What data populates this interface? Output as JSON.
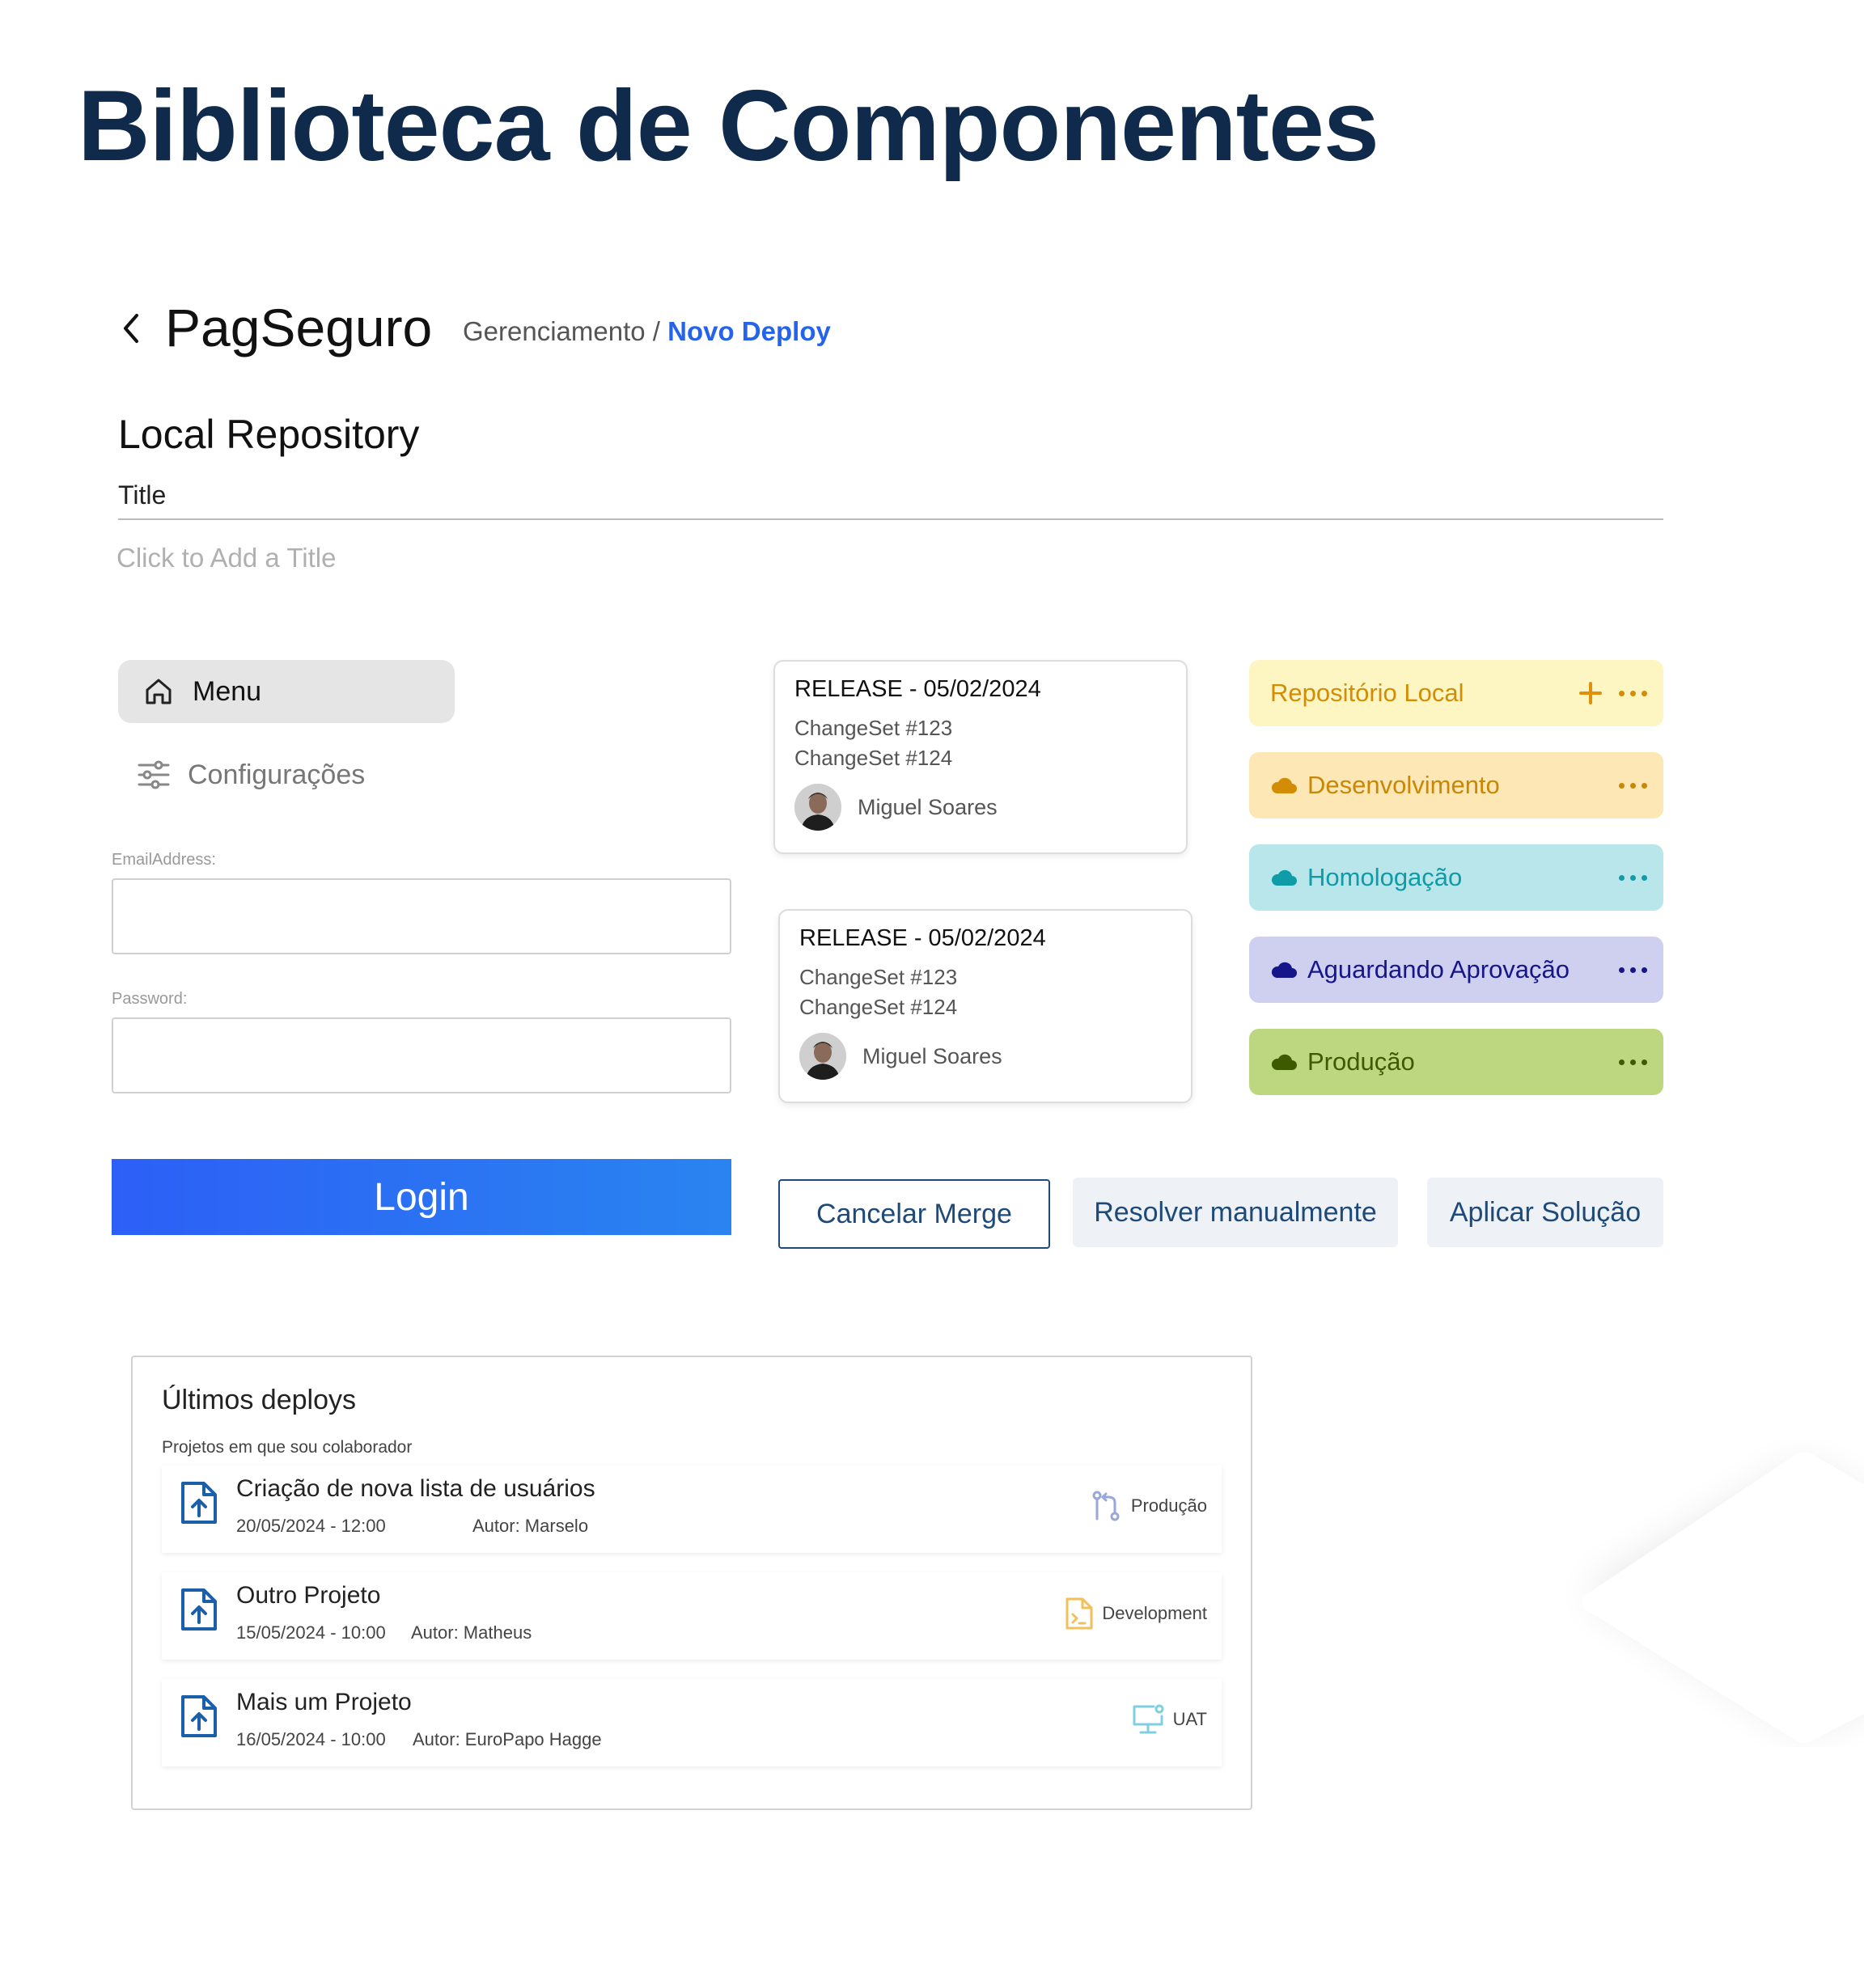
{
  "page": {
    "title": "Biblioteca de Componentes"
  },
  "header": {
    "brand": "PagSeguro",
    "breadcrumb_parent": "Gerenciamento",
    "breadcrumb_sep": " / ",
    "breadcrumb_current": "Novo Deploy"
  },
  "repository": {
    "title": "Local Repository",
    "field_label": "Title",
    "field_placeholder": "Click to Add a Title",
    "field_value": ""
  },
  "menu": {
    "items": [
      {
        "label": "Menu",
        "icon": "home-icon",
        "active": true
      },
      {
        "label": "Configurações",
        "icon": "sliders-icon",
        "active": false
      }
    ]
  },
  "form": {
    "email_label": "EmailAddress:",
    "email_value": "",
    "password_label": "Password:",
    "password_value": "",
    "login_label": "Login"
  },
  "releases": [
    {
      "title": "RELEASE - 05/02/2024",
      "changesets": [
        "ChangeSet #123",
        "ChangeSet #124"
      ],
      "author": "Miguel Soares"
    },
    {
      "title": "RELEASE - 05/02/2024",
      "changesets": [
        "ChangeSet #123",
        "ChangeSet #124"
      ],
      "author": "Miguel Soares"
    }
  ],
  "stages": [
    {
      "label": "Repositório Local",
      "icon": "plus-icon",
      "color": "#d38c05",
      "bg": "#fef6c2"
    },
    {
      "label": "Desenvolvimento",
      "icon": "cloud-icon",
      "color": "#c98706",
      "bg": "#fde7b4"
    },
    {
      "label": "Homologação",
      "icon": "cloud-icon",
      "color": "#0f9ba8",
      "bg": "#b9e6ea"
    },
    {
      "label": "Aguardando Aprovação",
      "icon": "cloud-icon",
      "color": "#16168a",
      "bg": "#cfd0f0"
    },
    {
      "label": "Produção",
      "icon": "cloud-icon",
      "color": "#3d5a00",
      "bg": "#bdd780"
    }
  ],
  "actions": {
    "cancel_merge": "Cancelar Merge",
    "resolve_manual": "Resolver manualmente",
    "apply_solution": "Aplicar Solução"
  },
  "deploys": {
    "title": "Últimos deploys",
    "subtitle": "Projetos em que sou colaborador",
    "items": [
      {
        "name": "Criação de nova lista de usuários",
        "date": "20/05/2024 - 12:00",
        "author": "Autor: Marselo",
        "env": "Produção",
        "env_icon": "git-merge-icon"
      },
      {
        "name": "Outro Projeto",
        "date": "15/05/2024 - 10:00",
        "author": "Autor: Matheus",
        "env": "Development",
        "env_icon": "terminal-file-icon"
      },
      {
        "name": "Mais um Projeto",
        "date": "16/05/2024 - 10:00",
        "author": "Autor: EuroPapo Hagge",
        "env": "UAT",
        "env_icon": "monitor-icon"
      }
    ]
  },
  "colors": {
    "title": "#0f2a4a",
    "link": "#2563eb",
    "primary_btn_from": "#2c5ff6",
    "primary_btn_to": "#2a84f0",
    "navy": "#1d4a78"
  }
}
